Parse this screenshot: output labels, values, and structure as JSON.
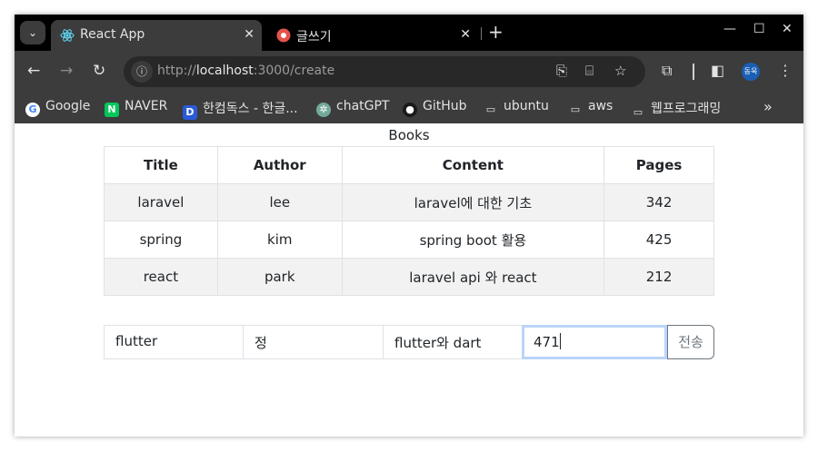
{
  "browser": {
    "tabs": [
      {
        "title": "React App",
        "icon": "react-icon",
        "active": true
      },
      {
        "title": "글쓰기",
        "icon": "app-favicon",
        "active": false
      }
    ],
    "new_tab_label": "+",
    "url": {
      "scheme": "http://",
      "host": "localhost",
      "path": ":3000/create"
    },
    "profile_initials": "동욱",
    "bookmarks": [
      {
        "label": "Google",
        "icon": "google-icon"
      },
      {
        "label": "NAVER",
        "icon": "naver-icon"
      },
      {
        "label": "한컴독스 - 한글...",
        "icon": "hancom-icon"
      },
      {
        "label": "chatGPT",
        "icon": "chatgpt-icon"
      },
      {
        "label": "GitHub",
        "icon": "github-icon"
      },
      {
        "label": "ubuntu",
        "icon": "folder-icon"
      },
      {
        "label": "aws",
        "icon": "folder-icon"
      },
      {
        "label": "웹프로그래밍",
        "icon": "folder-icon"
      }
    ],
    "more_bookmarks": "»"
  },
  "page": {
    "caption": "Books",
    "columns": [
      "Title",
      "Author",
      "Content",
      "Pages"
    ],
    "rows": [
      [
        "laravel",
        "lee",
        "laravel에 대한 기초",
        "342"
      ],
      [
        "spring",
        "kim",
        "spring boot 활용",
        "425"
      ],
      [
        "react",
        "park",
        "laravel api 와 react",
        "212"
      ]
    ],
    "form": {
      "title_value": "flutter",
      "author_value": "정",
      "content_value": "flutter와 dart",
      "pages_value": "471",
      "submit_label": "전송"
    }
  },
  "colors": {
    "tab_strip": "#000000",
    "toolbar": "#3c3c3c",
    "focus_ring": "#b9d4f9",
    "striped_row": "#f2f2f2"
  }
}
